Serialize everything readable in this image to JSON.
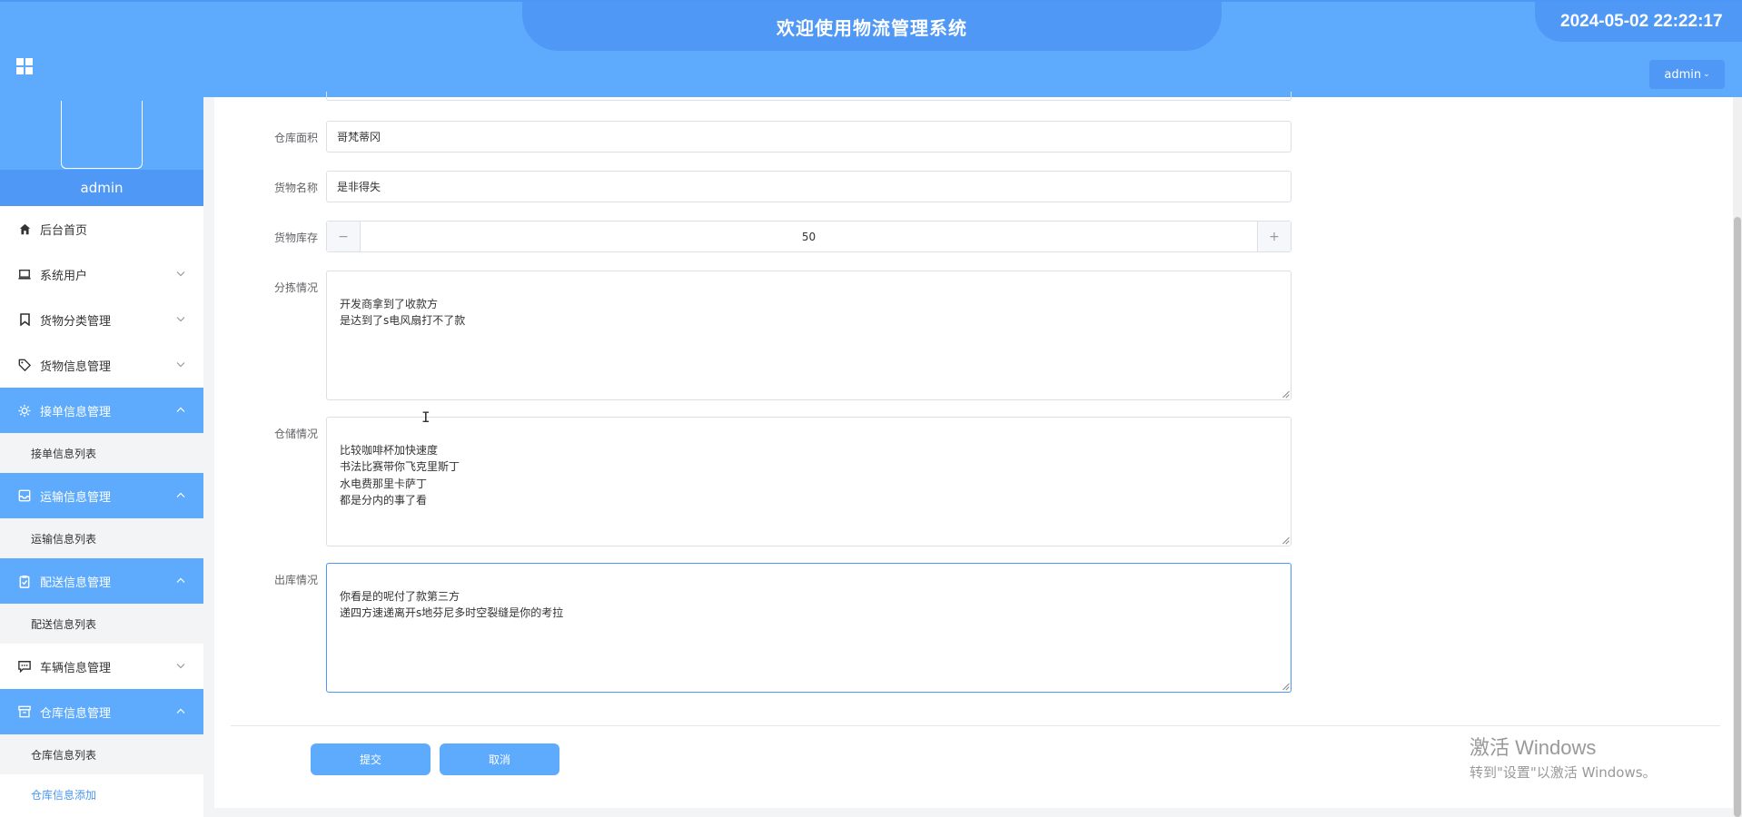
{
  "header": {
    "title": "欢迎使用物流管理系统",
    "datetime": "2024-05-02 22:22:17",
    "user_menu": "admin",
    "caret": "⌄"
  },
  "sidebar": {
    "username": "admin",
    "menu": [
      {
        "label": "后台首页",
        "icon": "home-icon"
      },
      {
        "label": "系统用户",
        "icon": "laptop-icon"
      },
      {
        "label": "货物分类管理",
        "icon": "bookmark-icon"
      },
      {
        "label": "货物信息管理",
        "icon": "tag-icon"
      },
      {
        "label": "接单信息管理",
        "icon": "sun-icon"
      },
      {
        "label": "接单信息列表"
      },
      {
        "label": "运输信息管理",
        "icon": "inbox-icon"
      },
      {
        "label": "运输信息列表"
      },
      {
        "label": "配送信息管理",
        "icon": "clipboard-icon"
      },
      {
        "label": "配送信息列表"
      },
      {
        "label": "车辆信息管理",
        "icon": "message-icon"
      },
      {
        "label": "仓库信息管理",
        "icon": "box-icon"
      },
      {
        "label": "仓库信息列表"
      },
      {
        "label": "仓库信息添加"
      }
    ]
  },
  "form": {
    "warehouse_area_label": "仓库面积",
    "warehouse_area_value": "哥梵蒂冈",
    "goods_name_label": "货物名称",
    "goods_name_value": "是非得失",
    "stock_label": "货物库存",
    "stock_value": "50",
    "stock_minus": "−",
    "stock_plus": "+",
    "sorting_label": "分拣情况",
    "sorting_value": "开发商拿到了收款方\n是达到了s电风扇打不了款",
    "storage_label": "仓储情况",
    "storage_value": "比较咖啡杯加快速度\n书法比赛带你飞克里斯丁\n水电费那里卡萨丁\n都是分内的事了看",
    "outbound_label": "出库情况",
    "outbound_value": "你看是的呢付了款第三方\n递四方速递离开s地芬尼多时空裂缝是你的考拉"
  },
  "buttons": {
    "submit": "提交",
    "cancel": "取消"
  },
  "watermark": {
    "title": "激活 Windows",
    "subtitle": "转到\"设置\"以激活 Windows。"
  },
  "colors": {
    "primary": "#5eabfd",
    "primary_dark": "#4f98f6"
  }
}
